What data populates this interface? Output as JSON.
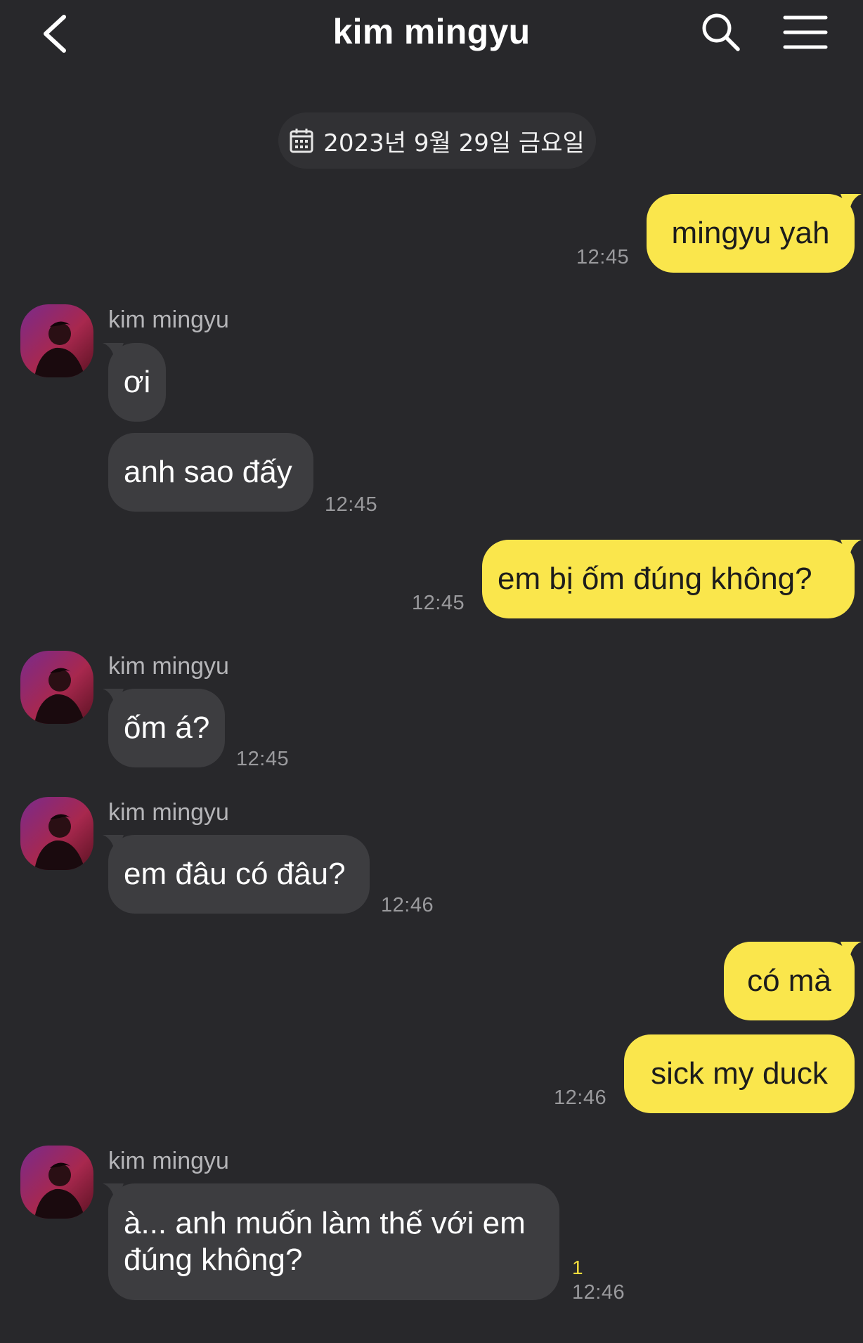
{
  "header": {
    "title": "kim mingyu",
    "back_icon": "chevron-left-icon",
    "search_icon": "search-icon",
    "menu_icon": "hamburger-menu-icon"
  },
  "date_divider": {
    "icon": "calendar-icon",
    "text": "2023년 9월 29일 금요일"
  },
  "colors": {
    "background": "#28282b",
    "outgoing_bubble": "#fae64c",
    "incoming_bubble": "#3d3d40",
    "unread_count": "#f2dc3c"
  },
  "messages": [
    {
      "from": "me",
      "text": "mingyu yah",
      "time": "12:45"
    },
    {
      "from": "kim mingyu",
      "sender_name": "kim mingyu",
      "text": "ơi"
    },
    {
      "from": "kim mingyu",
      "text": "anh sao đấy",
      "time": "12:45"
    },
    {
      "from": "me",
      "text": "em bị ốm đúng không?",
      "time": "12:45"
    },
    {
      "from": "kim mingyu",
      "sender_name": "kim mingyu",
      "text": "ốm á?",
      "time": "12:45"
    },
    {
      "from": "kim mingyu",
      "sender_name": "kim mingyu",
      "text": "em đâu có đâu?",
      "time": "12:46"
    },
    {
      "from": "me",
      "text": "có mà"
    },
    {
      "from": "me",
      "text": "sick my duck",
      "time": "12:46"
    },
    {
      "from": "kim mingyu",
      "sender_name": "kim mingyu",
      "text": "à... anh muốn làm thế với em đúng không?",
      "time": "12:46",
      "unread": "1"
    }
  ]
}
